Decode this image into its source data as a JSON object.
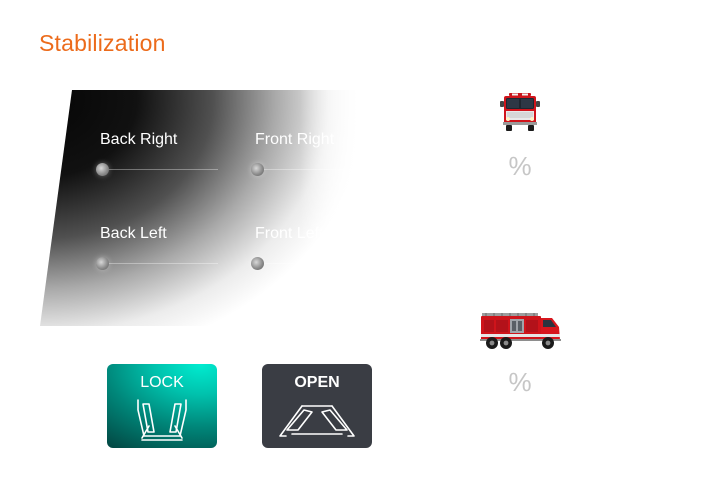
{
  "page": {
    "title": "Stabilization"
  },
  "legs": {
    "back_right": "Back Right",
    "front_right": "Front Right",
    "back_left": "Back Left",
    "front_left": "Front Left"
  },
  "status": {
    "front_percent": "%",
    "side_percent": "%"
  },
  "buttons": {
    "lock": "LOCK",
    "open": "OPEN"
  },
  "colors": {
    "title": "#ec6b1b",
    "lock_button": "#00c2ad",
    "open_button": "#3a3d44",
    "truck_red": "#d0141b"
  },
  "icons": {
    "front": "fire-truck-front-icon",
    "side": "fire-truck-side-icon",
    "lock": "outriggers-locked-icon",
    "open": "outriggers-open-icon"
  }
}
